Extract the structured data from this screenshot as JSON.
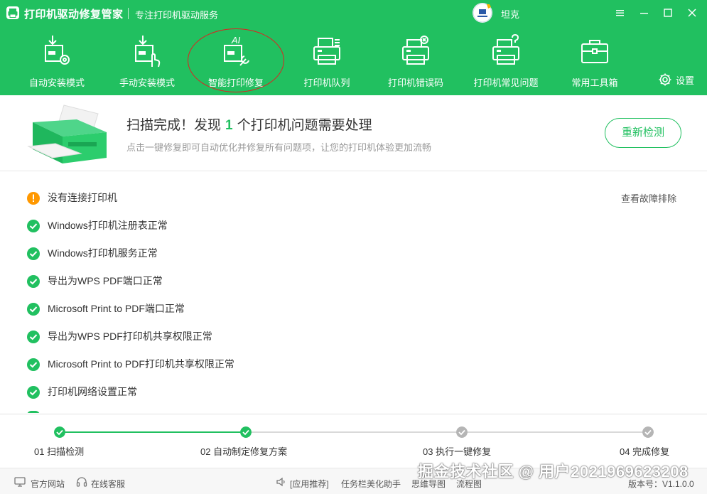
{
  "app": {
    "title": "打印机驱动修复管家",
    "subtitle": "专注打印机驱动服务",
    "user_name": "坦克"
  },
  "nav": {
    "items": [
      {
        "label": "自动安装模式",
        "icon": "download-gear-icon"
      },
      {
        "label": "手动安装模式",
        "icon": "download-hand-icon"
      },
      {
        "label": "智能打印修复",
        "icon": "ai-wrench-icon",
        "active": true
      },
      {
        "label": "打印机队列",
        "icon": "printer-queue-icon"
      },
      {
        "label": "打印机错误码",
        "icon": "printer-error-icon"
      },
      {
        "label": "打印机常见问题",
        "icon": "printer-question-icon"
      },
      {
        "label": "常用工具箱",
        "icon": "toolbox-icon"
      }
    ],
    "settings_label": "设置"
  },
  "scan": {
    "title_prefix": "扫描完成！发现",
    "count": "1",
    "title_suffix": "个打印机问题需要处理",
    "description": "点击一键修复即可自动优化并修复所有问题项，让您的打印机体验更加流畅",
    "rescan_label": "重新检测"
  },
  "results": {
    "troubleshoot_label": "查看故障排除",
    "items": [
      {
        "text": "没有连接打印机",
        "status": "warning"
      },
      {
        "text": "Windows打印机注册表正常",
        "status": "ok"
      },
      {
        "text": "Windows打印机服务正常",
        "status": "ok"
      },
      {
        "text": "导出为WPS PDF端口正常",
        "status": "ok"
      },
      {
        "text": "Microsoft Print to PDF端口正常",
        "status": "ok"
      },
      {
        "text": "导出为WPS PDF打印机共享权限正常",
        "status": "ok"
      },
      {
        "text": "Microsoft Print to PDF打印机共享权限正常",
        "status": "ok"
      },
      {
        "text": "打印机网络设置正常",
        "status": "ok"
      }
    ]
  },
  "steps": [
    {
      "label": "01 扫描检测",
      "state": "done"
    },
    {
      "label": "02 自动制定修复方案",
      "state": "done"
    },
    {
      "label": "03 执行一键修复",
      "state": "pending"
    },
    {
      "label": "04 完成修复",
      "state": "pending"
    }
  ],
  "footer": {
    "official_site": "官方网站",
    "online_service": "在线客服",
    "app_recommend": "[应用推荐]",
    "recommend_1": "任务栏美化助手",
    "recommend_2": "思维导图",
    "recommend_3": "流程图",
    "version": "版本号：V1.1.0.0"
  },
  "watermark": "掘金技术社区 @ 用户2021969623208",
  "colors": {
    "brand_green": "#21c060",
    "warning": "#ff9800",
    "pending_gray": "#b5b5b5",
    "annotation_red": "#e02020"
  }
}
